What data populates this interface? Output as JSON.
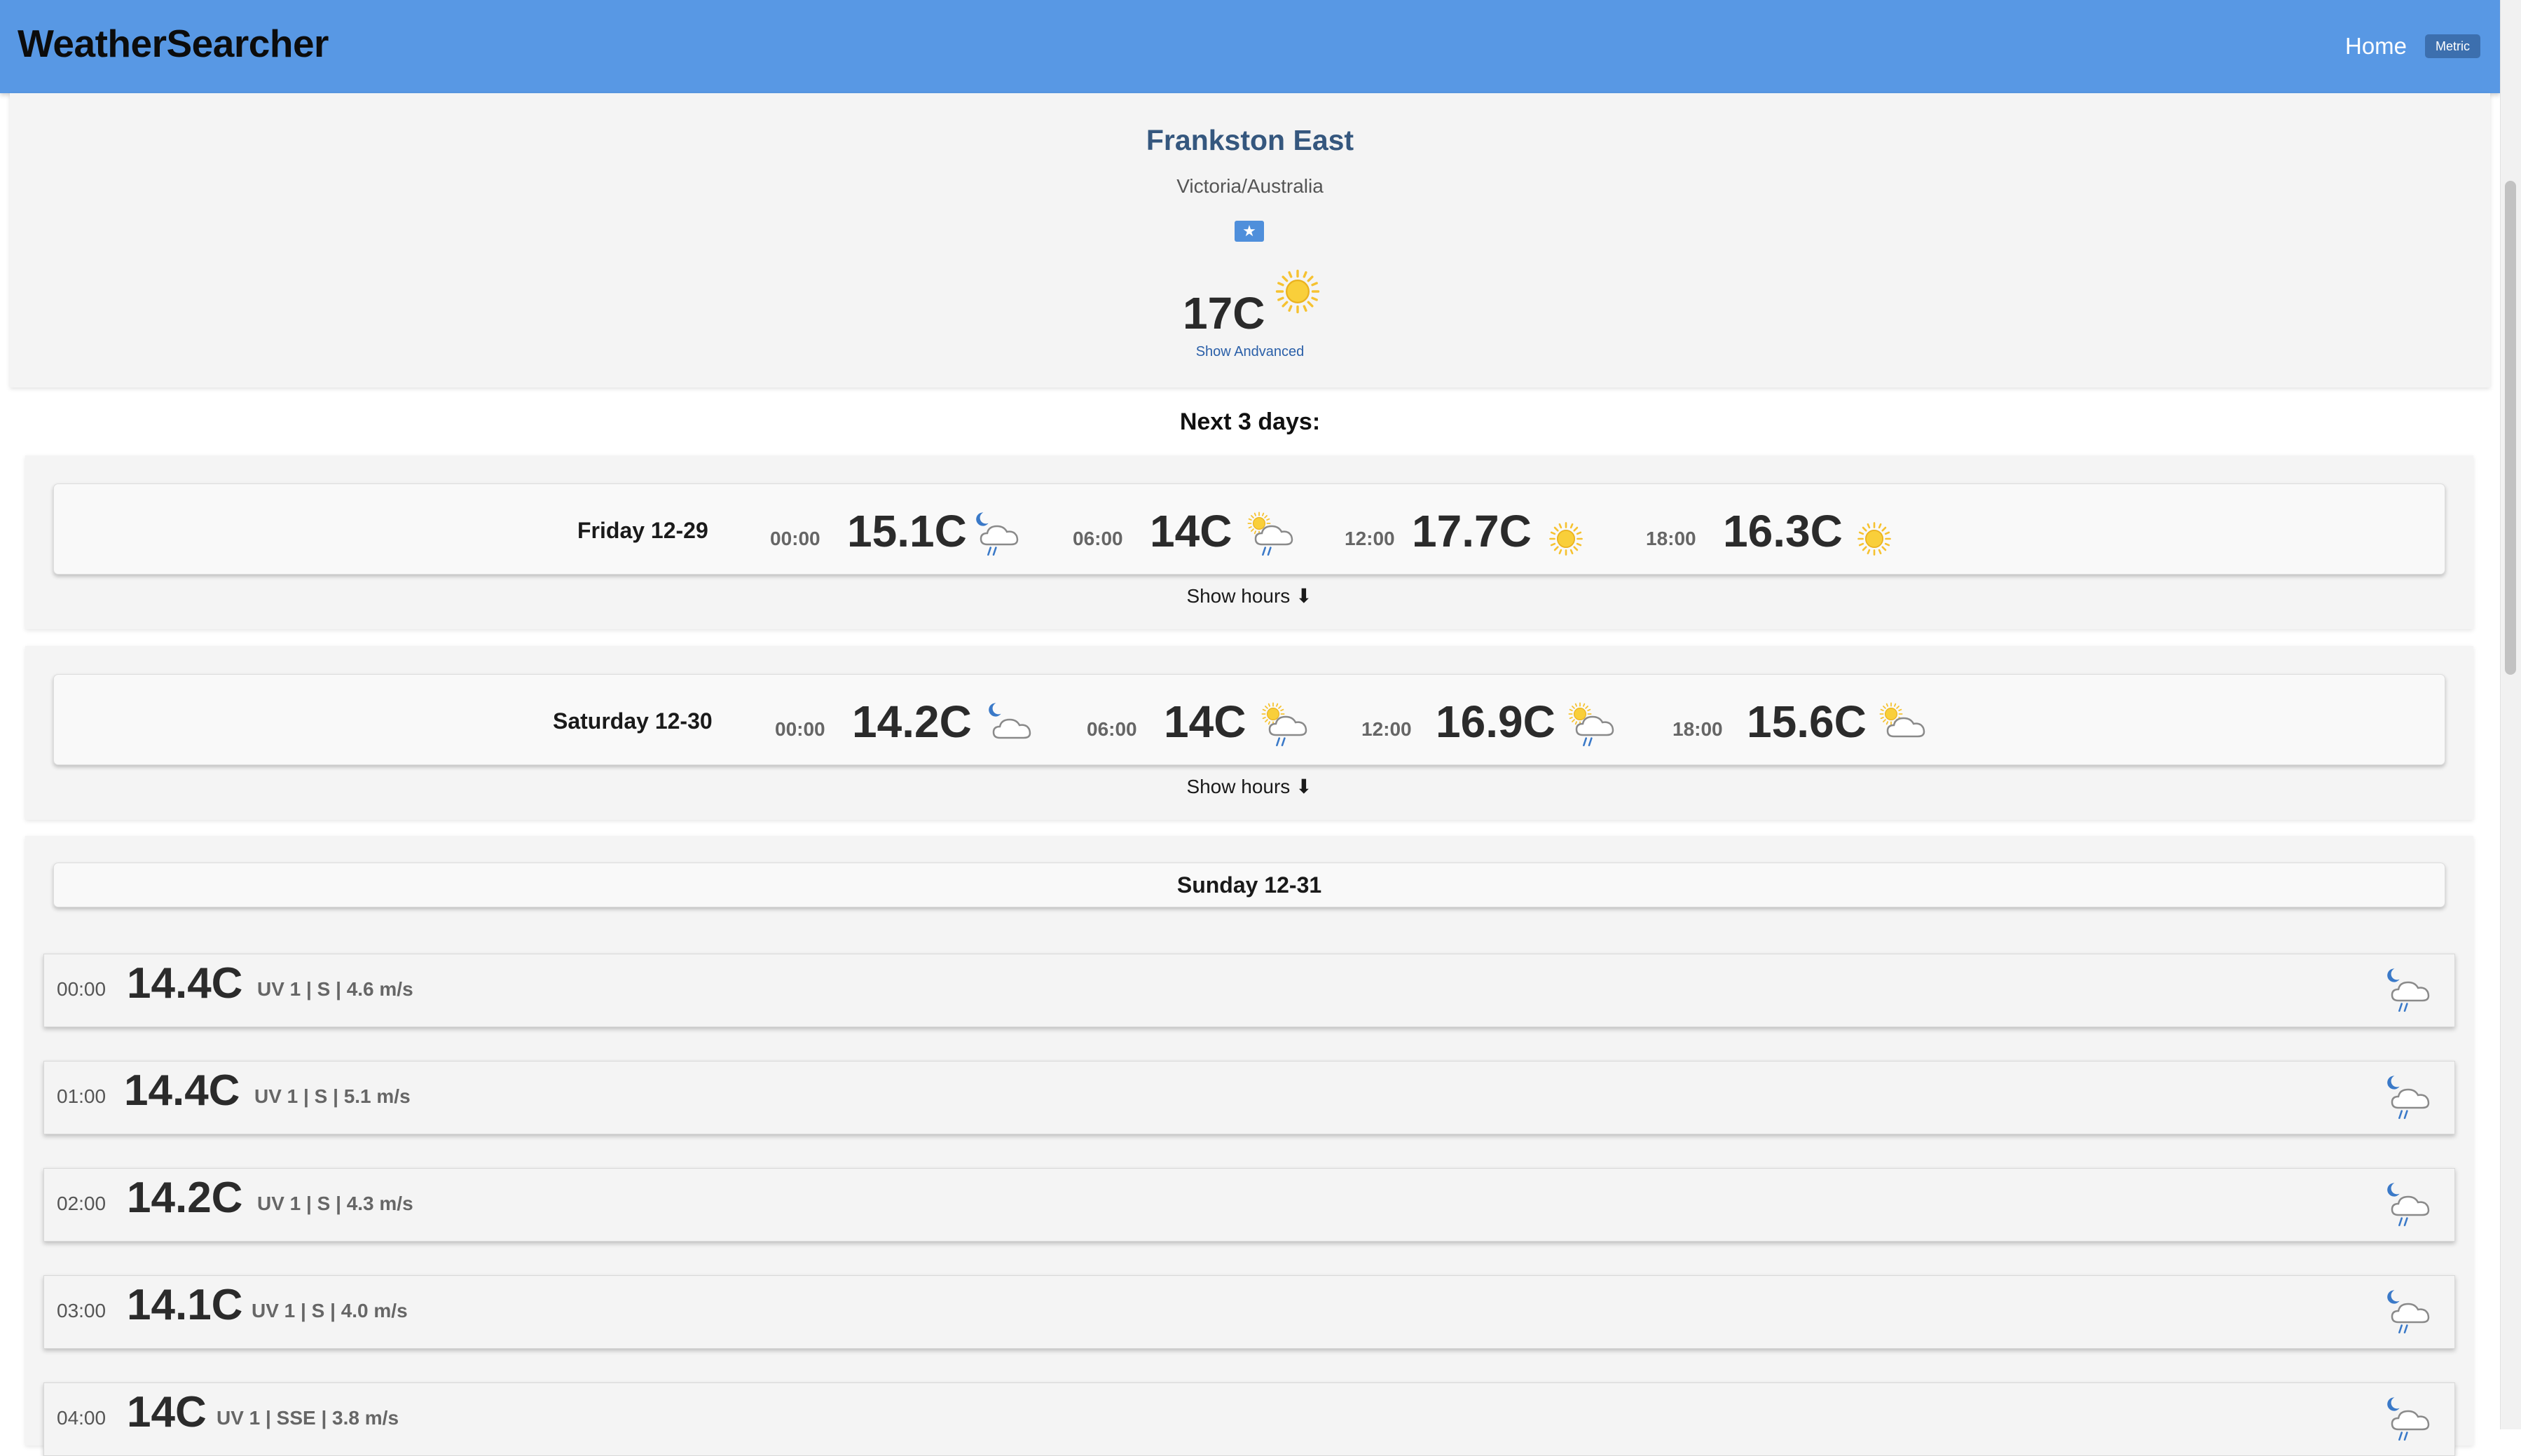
{
  "nav": {
    "brand": "WeatherSearcher",
    "home_label": "Home",
    "unit_label": "Metric"
  },
  "location": {
    "name": "Frankston East",
    "region": "Victoria/Australia",
    "favorite_icon": "star-icon",
    "current_temp": "17C",
    "current_icon": "sunny-icon",
    "advanced_link": "Show Andvanced"
  },
  "forecast_title": "Next 3 days:",
  "days": [
    {
      "label": "Friday 12-29",
      "periods": [
        {
          "time": "00:00",
          "temp": "15.1C",
          "icon": "night-rain-icon"
        },
        {
          "time": "06:00",
          "temp": "14C",
          "icon": "partly-sunny-rain-icon"
        },
        {
          "time": "12:00",
          "temp": "17.7C",
          "icon": "sunny-icon"
        },
        {
          "time": "18:00",
          "temp": "16.3C",
          "icon": "sunny-icon"
        }
      ],
      "show_hours_label": "Show hours ⬇"
    },
    {
      "label": "Saturday 12-30",
      "periods": [
        {
          "time": "00:00",
          "temp": "14.2C",
          "icon": "night-cloudy-icon"
        },
        {
          "time": "06:00",
          "temp": "14C",
          "icon": "partly-sunny-rain-icon"
        },
        {
          "time": "12:00",
          "temp": "16.9C",
          "icon": "partly-sunny-rain-icon"
        },
        {
          "time": "18:00",
          "temp": "15.6C",
          "icon": "partly-sunny-icon"
        }
      ],
      "show_hours_label": "Show hours ⬇"
    },
    {
      "label": "Sunday 12-31",
      "hours": [
        {
          "time": "00:00",
          "temp": "14.4C",
          "details": "UV 1 | S | 4.6 m/s",
          "icon": "night-rain-icon"
        },
        {
          "time": "01:00",
          "temp": "14.4C",
          "details": "UV 1 | S | 5.1 m/s",
          "icon": "night-rain-icon"
        },
        {
          "time": "02:00",
          "temp": "14.2C",
          "details": "UV 1 | S | 4.3 m/s",
          "icon": "night-rain-icon"
        },
        {
          "time": "03:00",
          "temp": "14.1C",
          "details": "UV 1 | S | 4.0 m/s",
          "icon": "night-rain-icon"
        },
        {
          "time": "04:00",
          "temp": "14C",
          "details": "UV 1 | SSE | 3.8 m/s",
          "icon": "night-rain-icon"
        }
      ]
    }
  ],
  "colors": {
    "navbar": "#5898e4",
    "location_title": "#35577e",
    "sun": "#f6c230",
    "moon": "#3a79c8",
    "rain": "#3a79c8"
  }
}
